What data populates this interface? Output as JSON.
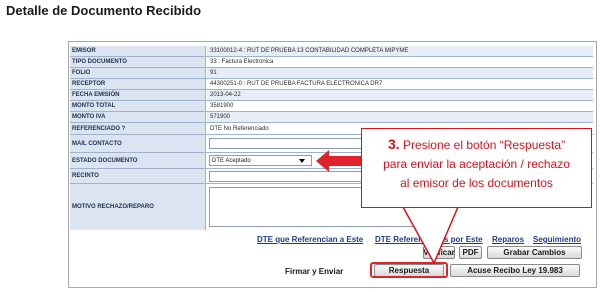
{
  "page": {
    "title": "Detalle de Documento Recibido"
  },
  "fields": [
    {
      "label": "EMISOR",
      "value": "33100012-4 : RUT DE PRUEBA 13 CONTABILIDAD COMPLETA MIPYME"
    },
    {
      "label": "TIPO DOCUMENTO",
      "value": "33 : Factura Electronica"
    },
    {
      "label": "FOLIO",
      "value": "91"
    },
    {
      "label": "RECEPTOR",
      "value": "44300251-0 : RUT DE PRUEBA FACTURA ELECTRONICA DR7"
    },
    {
      "label": "FECHA EMISIÓN",
      "value": "2013-04-22"
    },
    {
      "label": "MONTO TOTAL",
      "value": "3581900"
    },
    {
      "label": "MONTO IVA",
      "value": "571900"
    },
    {
      "label": "REFERENCIADO ?",
      "value": "DTE No Referenciado"
    },
    {
      "label": "MAIL CONTACTO",
      "value": ""
    },
    {
      "label": "ESTADO DOCUMENTO",
      "value": ""
    },
    {
      "label": "RECINTO",
      "value": ""
    },
    {
      "label": "MOTIVO RECHAZO/REPARO",
      "value": ""
    }
  ],
  "estado_select": {
    "selected": "DTE Aceptado"
  },
  "links": {
    "referencian": "DTE que Referencian a Este",
    "referenciados": "DTE Referenciados por Este",
    "reparos": "Reparos",
    "seguimiento": "Seguimiento"
  },
  "buttons": {
    "verificar": "Verificar",
    "pdf": "PDF",
    "grabar": "Grabar Cambios",
    "firmar_label": "Firmar y Enviar",
    "respuesta": "Respuesta",
    "acuse": "Acuse Recibo Ley 19.983"
  },
  "callout": {
    "number": "3.",
    "line1": "Presione el botón “Respuesta”",
    "line2": "para enviar la aceptación / rechazo",
    "line3": "al emisor de los documentos"
  },
  "colors": {
    "accent": "#d4141b",
    "label_bg": "#dbe5f1",
    "link": "#1f3c8c"
  }
}
